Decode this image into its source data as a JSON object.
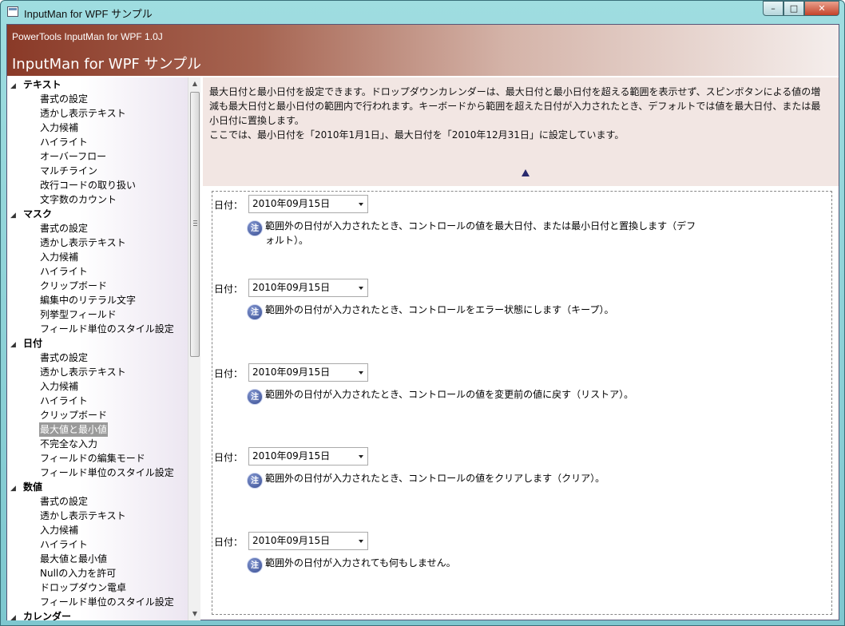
{
  "window": {
    "title": "InputMan for WPF サンプル"
  },
  "caption_buttons": {
    "minimize": "–",
    "maximize": "□",
    "close": "✕"
  },
  "banner": {
    "product": "PowerTools InputMan for WPF 1.0J",
    "title": "InputMan for WPF サンプル"
  },
  "tree": {
    "categories": [
      {
        "label": "テキスト",
        "items": [
          "書式の設定",
          "透かし表示テキスト",
          "入力候補",
          "ハイライト",
          "オーバーフロー",
          "マルチライン",
          "改行コードの取り扱い",
          "文字数のカウント"
        ]
      },
      {
        "label": "マスク",
        "items": [
          "書式の設定",
          "透かし表示テキスト",
          "入力候補",
          "ハイライト",
          "クリップボード",
          "編集中のリテラル文字",
          "列挙型フィールド",
          "フィールド単位のスタイル設定"
        ]
      },
      {
        "label": "日付",
        "items": [
          "書式の設定",
          "透かし表示テキスト",
          "入力候補",
          "ハイライト",
          "クリップボード",
          "最大値と最小値",
          "不完全な入力",
          "フィールドの編集モード",
          "フィールド単位のスタイル設定"
        ]
      },
      {
        "label": "数値",
        "items": [
          "書式の設定",
          "透かし表示テキスト",
          "入力候補",
          "ハイライト",
          "最大値と最小値",
          "Nullの入力を許可",
          "ドロップダウン電卓",
          "フィールド単位のスタイル設定"
        ]
      },
      {
        "label": "カレンダー",
        "items": []
      }
    ],
    "selected": "最大値と最小値"
  },
  "description": {
    "line1": "最大日付と最小日付を設定できます。ドロップダウンカレンダーは、最大日付と最小日付を超える範囲を表示せず、スピンボタンによる値の増",
    "line2": "減も最大日付と最小日付の範囲内で行われます。キーボードから範囲を超えた日付が入力されたとき、デフォルトでは値を最大日付、または最",
    "line3": "小日付に置換します。",
    "line4": "ここでは、最小日付を「2010年1月1日」、最大日付を「2010年12月31日」に設定しています。"
  },
  "samples": [
    {
      "label": "日付：",
      "value": "2010年09月15日",
      "note_icon": "注",
      "note": "範囲外の日付が入力されたとき、コントロールの値を最大日付、または最小日付と置換します（デフォルト）。"
    },
    {
      "label": "日付：",
      "value": "2010年09月15日",
      "note_icon": "注",
      "note": "範囲外の日付が入力されたとき、コントロールをエラー状態にします（キープ）。"
    },
    {
      "label": "日付：",
      "value": "2010年09月15日",
      "note_icon": "注",
      "note": "範囲外の日付が入力されたとき、コントロールの値を変更前の値に戻す（リストア）。"
    },
    {
      "label": "日付：",
      "value": "2010年09月15日",
      "note_icon": "注",
      "note": "範囲外の日付が入力されたとき、コントロールの値をクリアします（クリア）。"
    },
    {
      "label": "日付：",
      "value": "2010年09月15日",
      "note_icon": "注",
      "note": "範囲外の日付が入力されても何もしません。"
    }
  ]
}
